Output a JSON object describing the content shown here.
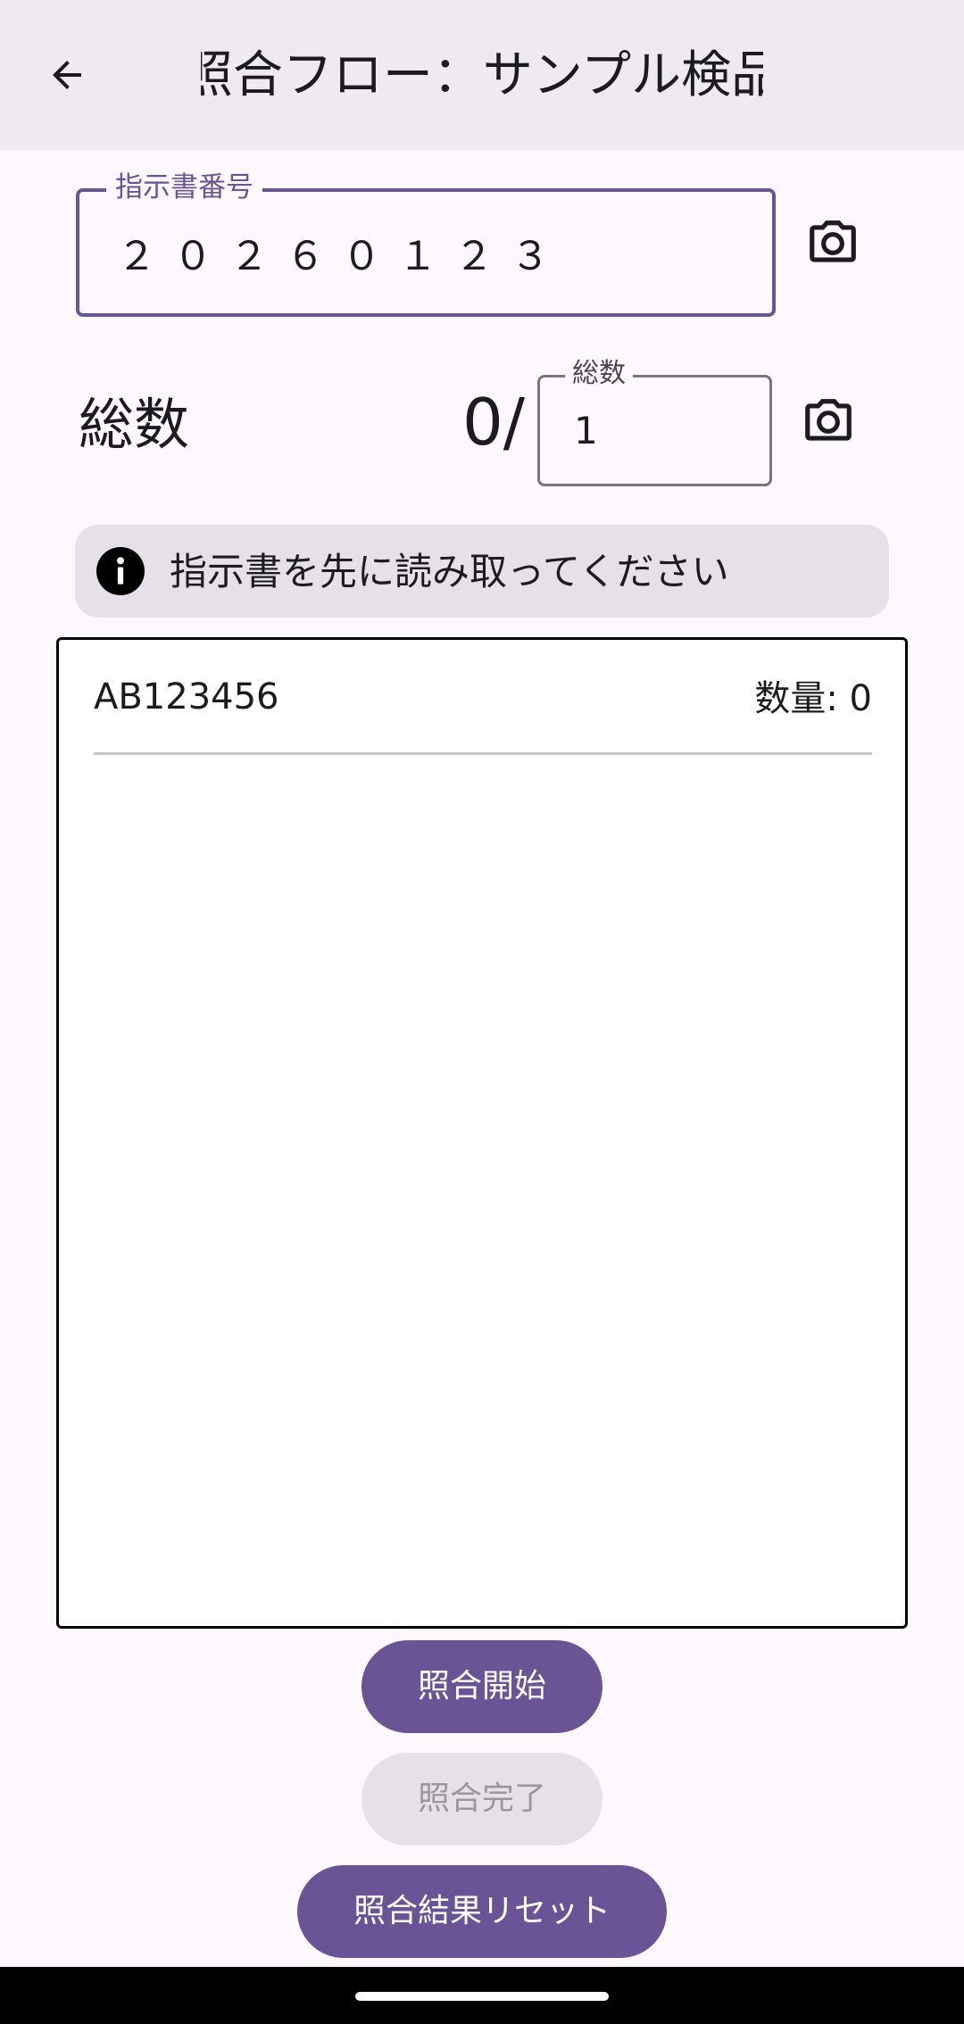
{
  "app_bar": {
    "title": "照合フロー：サンプル検品",
    "back_icon": "arrow-left-icon"
  },
  "instruction_field": {
    "label": "指示書番号",
    "value": "２０２６０１２３",
    "camera_icon": "camera-icon"
  },
  "total_row": {
    "label": "総数",
    "count_prefix": "0/",
    "field_label": "総数",
    "field_value": "1",
    "camera_icon": "camera-icon"
  },
  "info_banner": {
    "icon": "info-icon",
    "text": "指示書を先に読み取ってください"
  },
  "items": [
    {
      "code": "AB123456",
      "quantity_text": "数量: 0"
    }
  ],
  "buttons": {
    "start": "照合開始",
    "complete": "照合完了",
    "reset": "照合結果リセット"
  },
  "colors": {
    "primary": "#6a5495",
    "app_bar_bg": "#efeaf1",
    "page_bg": "#fdf7fe",
    "banner_bg": "#e6e0e9",
    "disabled_text": "#9a96a0"
  }
}
